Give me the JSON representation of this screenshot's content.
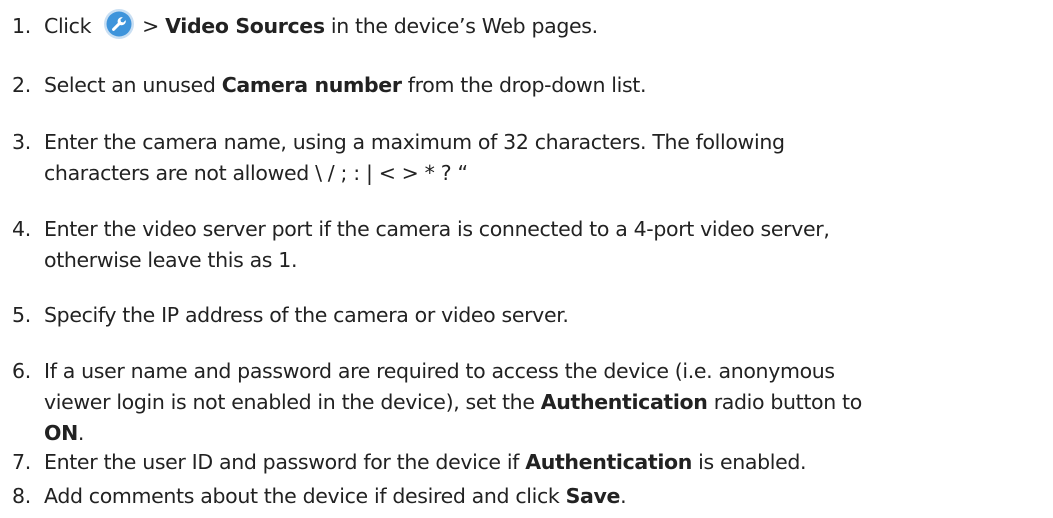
{
  "steps": [
    {
      "num": "1.",
      "lead": "Click",
      "icon": "wrench-settings-icon",
      "sep": ">",
      "b1": "Video Sources",
      "t1": "in the device’s Web pages."
    },
    {
      "num": "2.",
      "t1": "Select an unused",
      "b1": "Camera number",
      "t2": "from the drop-down list."
    },
    {
      "num": "3.",
      "line1": "Enter the camera name, using a maximum of 32 characters. The following",
      "line2": "characters are not allowed \\ / ; : | < > * ? “"
    },
    {
      "num": "4.",
      "line1": "Enter the video server port if the camera is connected to a 4-port video server,",
      "line2": "otherwise leave this as 1."
    },
    {
      "num": "5.",
      "line1": "Specify the IP address of the camera or video server."
    },
    {
      "num": "6.",
      "line1": "If a user name and password are required to access the device (i.e. anonymous",
      "line2": "viewer login is not enabled in the device), set the",
      "b1": "Authentication",
      "line2b": "radio button to",
      "b2": "ON",
      "line3b": "."
    },
    {
      "num": "7.",
      "t1": "Enter the user ID and password for the device if",
      "b1": "Authentication",
      "t2": "is enabled."
    },
    {
      "num": "8.",
      "t1": "Add comments about the device if desired and click",
      "b1": "Save",
      "t2": "."
    }
  ],
  "colors": {
    "icon_ring": "#c9dff3",
    "icon_fill": "#3e94db",
    "icon_glyph": "#ffffff"
  }
}
